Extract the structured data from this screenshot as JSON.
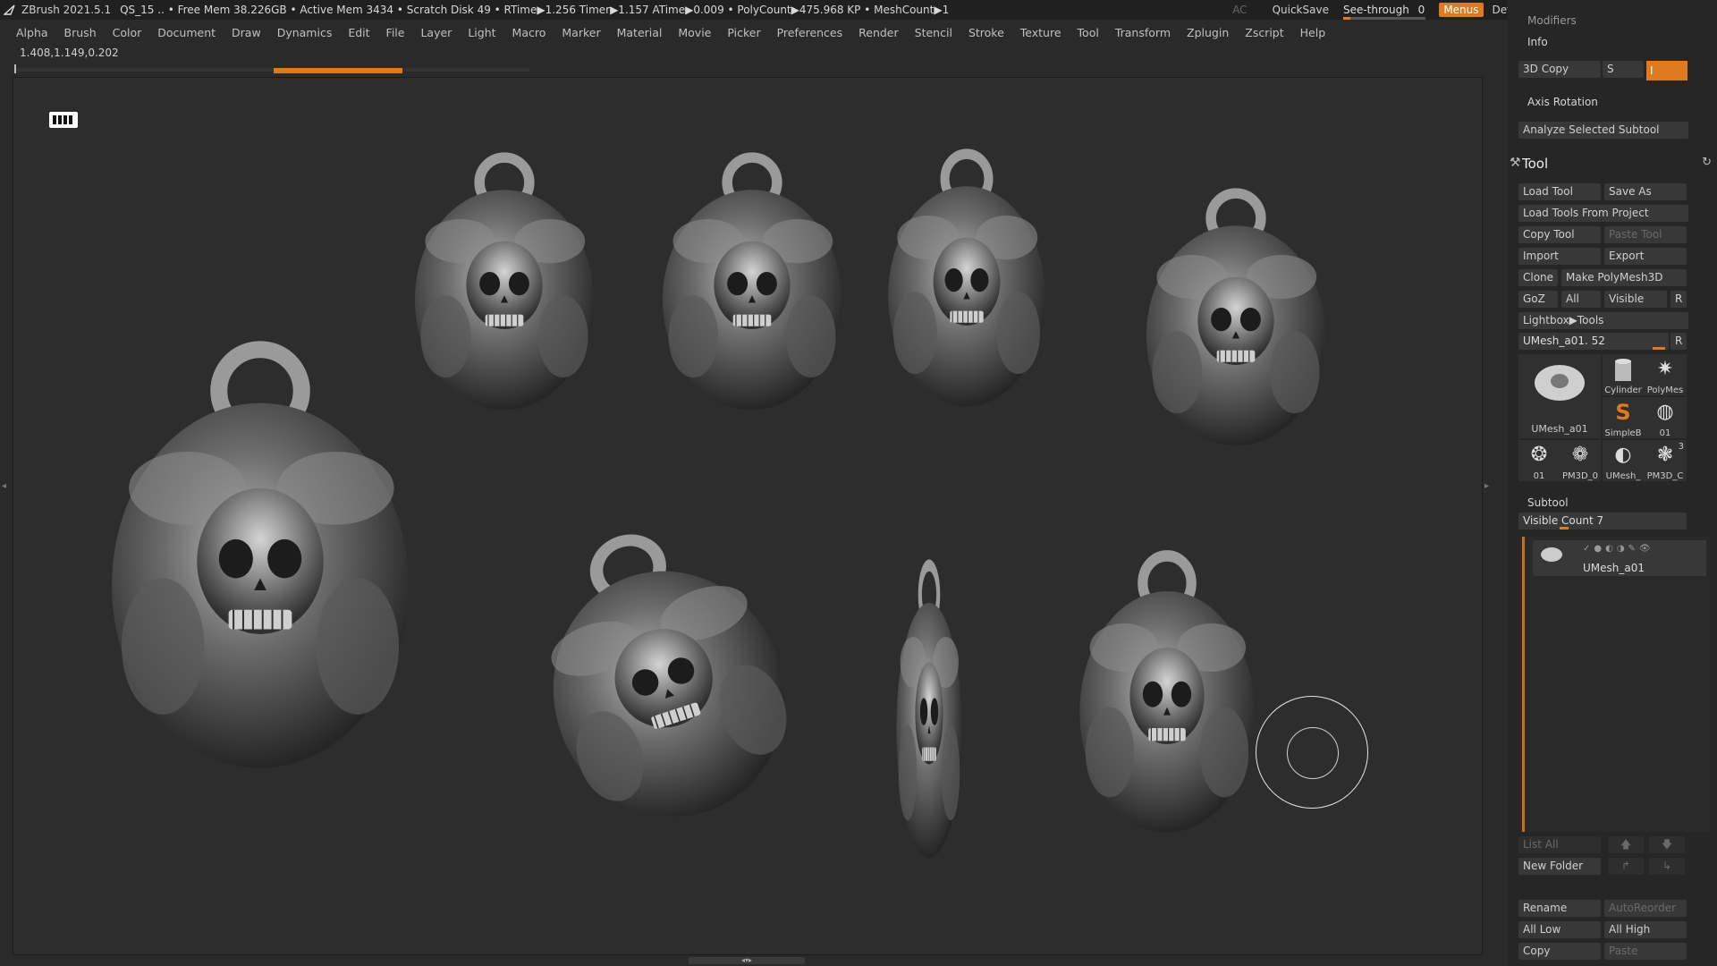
{
  "topbar": {
    "app_title": "ZBrush 2021.5.1",
    "stats": "QS_15   .. • Free Mem 38.226GB • Active Mem 3434 • Scratch Disk 49 •  RTime▶1.256 Timer▶1.157 ATime▶0.009 • PolyCount▶475.968 KP  • MeshCount▶1",
    "ac_label": "AC",
    "quicksave_label": "QuickSave",
    "seethrough_label": "See-through",
    "seethrough_value": "0",
    "menus_label": "Menus",
    "script_label": "DefaultZScript",
    "accent_color": "#e07a1e"
  },
  "menubar": {
    "items": [
      "Alpha",
      "Brush",
      "Color",
      "Document",
      "Draw",
      "Dynamics",
      "Edit",
      "File",
      "Layer",
      "Light",
      "Macro",
      "Marker",
      "Material",
      "Movie",
      "Picker",
      "Preferences",
      "Render",
      "Stencil",
      "Stroke",
      "Texture",
      "Tool",
      "Transform",
      "Zplugin",
      "Zscript",
      "Help"
    ]
  },
  "coords": "1.408,1.149,0.202",
  "panel": {
    "modifiers_label": "Modifiers",
    "info_label": "Info",
    "copy3d_label": "3D Copy",
    "s_label": "S",
    "i_value": "I",
    "axis_rotation_label": "Axis Rotation",
    "analyze_label": "Analyze Selected Subtool",
    "tool_title": "Tool",
    "buttons": {
      "load_tool": "Load Tool",
      "save_as": "Save As",
      "load_from_project": "Load Tools From Project",
      "copy_tool": "Copy Tool",
      "paste_tool": "Paste Tool",
      "import": "Import",
      "export": "Export",
      "clone": "Clone",
      "make_polymesh": "Make PolyMesh3D",
      "goz": "GoZ",
      "all": "All",
      "visible": "Visible",
      "r": "R",
      "lightbox_tools": "Lightbox▶Tools"
    },
    "current_tool_label": "UMesh_a01. 52",
    "current_tool_r": "R",
    "thumbs": {
      "main": "UMesh_a01",
      "cylinder": "Cylinder",
      "polymesh": "PolyMes",
      "simpleb": "SimpleB",
      "t01": "01",
      "t01b": "01",
      "pm3d_0": "PM3D_0",
      "umesh": "UMesh_",
      "pm3d_c": "PM3D_C",
      "count3": "3"
    },
    "subtool_label": "Subtool",
    "visible_count_label": "Visible Count 7",
    "subtool_item_name": "UMesh_a01",
    "list_all_label": "List All",
    "new_folder_label": "New Folder",
    "rename_label": "Rename",
    "autoreorder_label": "AutoReorder",
    "all_low_label": "All Low",
    "all_high_label": "All High",
    "copy_label": "Copy",
    "paste_label": "Paste"
  }
}
